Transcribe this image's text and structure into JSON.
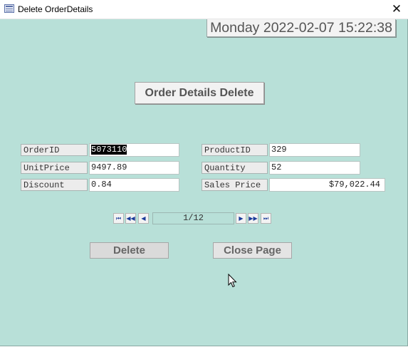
{
  "window": {
    "title": "Delete OrderDetails",
    "close_glyph": "✕",
    "app_icon": "form-icon"
  },
  "datetime": "Monday 2022-02-07 15:22:38",
  "header_label": "Order Details Delete",
  "fields": {
    "order_id": {
      "label": "OrderID",
      "value": "5073110"
    },
    "product_id": {
      "label": "ProductID",
      "value": "329"
    },
    "unit_price": {
      "label": "UnitPrice",
      "value": "9497.89"
    },
    "quantity": {
      "label": "Quantity",
      "value": "52"
    },
    "discount": {
      "label": "Discount",
      "value": "0.84"
    },
    "sales_price": {
      "label": "Sales Price",
      "value": "$79,022.44"
    }
  },
  "navigator": {
    "first": "⏮",
    "prev_page": "◀◀",
    "prev": "◀",
    "position": "1/12",
    "next": "▶",
    "next_page": "▶▶",
    "last": "⏭"
  },
  "buttons": {
    "delete": "Delete",
    "close_page": "Close Page"
  },
  "colors": {
    "form_background": "#b8e0d8",
    "nav_glyph": "#1b3c9a"
  }
}
